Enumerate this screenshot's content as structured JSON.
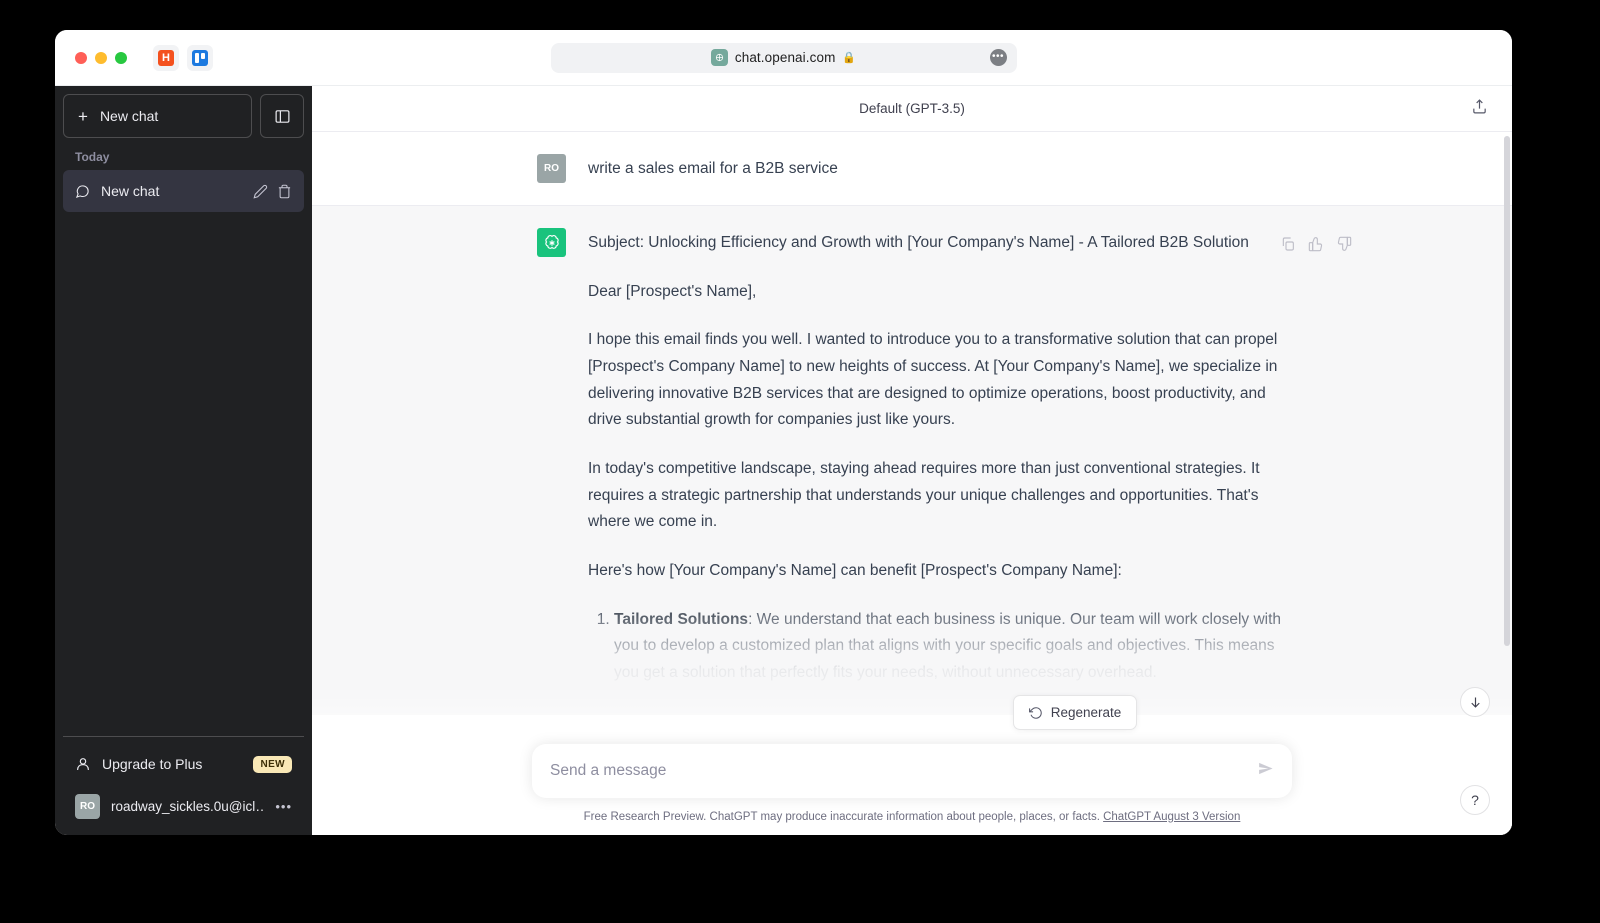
{
  "browser": {
    "url": "chat.openai.com",
    "lock_icon": "lock-icon",
    "favicon": "openai-favicon",
    "more_icon": "•••",
    "extensions": [
      {
        "name": "hubspot-extension",
        "glyph": "H"
      },
      {
        "name": "trello-extension",
        "glyph": ""
      }
    ],
    "traffic_lights": [
      "close",
      "minimize",
      "maximize"
    ]
  },
  "sidebar": {
    "new_chat_label": "New chat",
    "new_chat_icon": "plus-icon",
    "collapse_icon": "sidebar-toggle-icon",
    "section_label": "Today",
    "chat_items": [
      {
        "label": "New chat",
        "icon": "chat-bubble-icon",
        "edit_icon": "pencil-icon",
        "delete_icon": "trash-icon",
        "active": true
      }
    ],
    "upgrade": {
      "label": "Upgrade to Plus",
      "icon": "person-icon",
      "badge": "NEW"
    },
    "account": {
      "initials": "RO",
      "email": "roadway_sickles.0u@icl…",
      "more_icon": "•••"
    }
  },
  "header": {
    "model_label": "Default (GPT-3.5)",
    "share_icon": "share-icon"
  },
  "conversation": {
    "user_message": {
      "initials": "RO",
      "text": "write a sales email for a B2B service"
    },
    "assistant_message": {
      "avatar_icon": "openai-logo-icon",
      "paragraphs": [
        "Subject: Unlocking Efficiency and Growth with [Your Company's Name] - A Tailored B2B Solution",
        "Dear [Prospect's Name],",
        "I hope this email finds you well. I wanted to introduce you to a transformative solution that can propel [Prospect's Company Name] to new heights of success. At [Your Company's Name], we specialize in delivering innovative B2B services that are designed to optimize operations, boost productivity, and drive substantial growth for companies just like yours.",
        "In today's competitive landscape, staying ahead requires more than just conventional strategies. It requires a strategic partnership that understands your unique challenges and opportunities. That's where we come in.",
        "Here's how [Your Company's Name] can benefit [Prospect's Company Name]:"
      ],
      "list_items": [
        {
          "title": "Tailored Solutions",
          "body": ": We understand that each business is unique. Our team will work closely with you to develop a customized plan that aligns with your specific goals and objectives. This means you get a solution that perfectly fits your needs, without unnecessary overhead."
        }
      ],
      "actions": [
        {
          "name": "copy-icon",
          "label": "Copy"
        },
        {
          "name": "thumbs-up-icon",
          "label": "Good response"
        },
        {
          "name": "thumbs-down-icon",
          "label": "Bad response"
        }
      ]
    }
  },
  "composer": {
    "regenerate_label": "Regenerate",
    "regenerate_icon": "refresh-icon",
    "placeholder": "Send a message",
    "value": "",
    "send_icon": "send-icon"
  },
  "footer": {
    "text_before": "Free Research Preview. ChatGPT may produce inaccurate information about people, places, or facts. ",
    "link_text": "ChatGPT August 3 Version"
  },
  "floating": {
    "scroll_down_icon": "arrow-down-icon",
    "help_label": "?"
  },
  "colors": {
    "sidebar_bg": "#202123",
    "active_item": "#343541",
    "brand_green": "#19c37d",
    "badge_yellow": "#f9e8b6"
  }
}
